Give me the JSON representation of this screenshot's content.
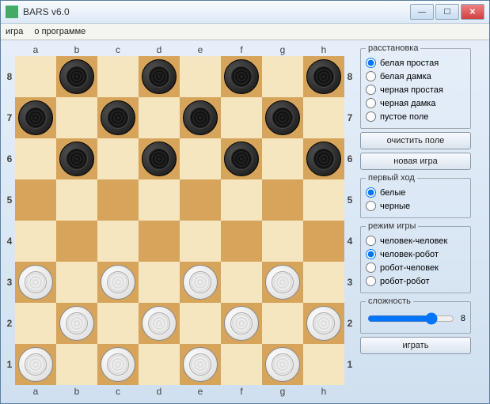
{
  "window": {
    "title": "BARS v6.0"
  },
  "menu": {
    "game": "игра",
    "about": "о программе"
  },
  "files": "abcdefgh",
  "ranks": "87654321",
  "pieces": {
    "b8": "black",
    "d8": "black",
    "f8": "black",
    "h8": "black",
    "a7": "black",
    "c7": "black",
    "e7": "black",
    "g7": "black",
    "b6": "black",
    "d6": "black",
    "f6": "black",
    "h6": "black",
    "a3": "white",
    "c3": "white",
    "e3": "white",
    "g3": "white",
    "b2": "white",
    "d2": "white",
    "f2": "white",
    "h2": "white",
    "a1": "white",
    "c1": "white",
    "e1": "white",
    "g1": "white"
  },
  "setup": {
    "legend": "расстановка",
    "options": [
      "белая простая",
      "белая дамка",
      "черная простая",
      "черная дамка",
      "пустое поле"
    ],
    "selected": 0
  },
  "buttons": {
    "clear": "очистить поле",
    "newgame": "новая игра",
    "play": "играть"
  },
  "firstMove": {
    "legend": "первый ход",
    "options": [
      "белые",
      "черные"
    ],
    "selected": 0
  },
  "mode": {
    "legend": "режим игры",
    "options": [
      "человек-человек",
      "человек-робот",
      "робот-человек",
      "робот-робот"
    ],
    "selected": 1
  },
  "difficulty": {
    "legend": "сложность",
    "value": 8,
    "min": 1,
    "max": 10
  }
}
